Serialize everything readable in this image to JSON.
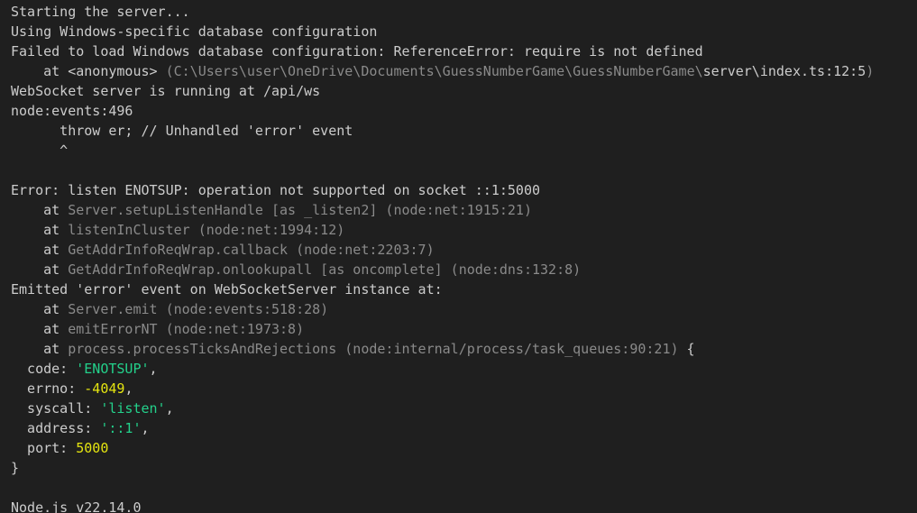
{
  "terminal": {
    "lines": [
      [
        {
          "t": "Starting the server...",
          "c": "plain"
        }
      ],
      [
        {
          "t": "Using Windows-specific database configuration",
          "c": "plain"
        }
      ],
      [
        {
          "t": "Failed to load Windows database configuration: ReferenceError: require is not defined",
          "c": "plain"
        }
      ],
      [
        {
          "t": "    at <anonymous> ",
          "c": "plain"
        },
        {
          "t": "(C:\\Users\\user\\OneDrive\\Documents\\GuessNumberGame\\GuessNumberGame\\",
          "c": "dim"
        },
        {
          "t": "server\\index.ts:12:5",
          "c": "plain"
        },
        {
          "t": ")",
          "c": "dim"
        }
      ],
      [
        {
          "t": "WebSocket server is running at /api/ws",
          "c": "plain"
        }
      ],
      [
        {
          "t": "node:events:496",
          "c": "plain"
        }
      ],
      [
        {
          "t": "      throw er; // Unhandled 'error' event",
          "c": "plain"
        }
      ],
      [
        {
          "t": "      ^",
          "c": "plain"
        }
      ],
      [
        {
          "t": "",
          "c": "plain"
        }
      ],
      [
        {
          "t": "Error: listen ENOTSUP: operation not supported on socket ::1:5000",
          "c": "plain"
        }
      ],
      [
        {
          "t": "    at ",
          "c": "plain"
        },
        {
          "t": "Server.setupListenHandle [as _listen2] (node:net:1915:21)",
          "c": "dim"
        }
      ],
      [
        {
          "t": "    at ",
          "c": "plain"
        },
        {
          "t": "listenInCluster (node:net:1994:12)",
          "c": "dim"
        }
      ],
      [
        {
          "t": "    at ",
          "c": "plain"
        },
        {
          "t": "GetAddrInfoReqWrap.callback (node:net:2203:7)",
          "c": "dim"
        }
      ],
      [
        {
          "t": "    at ",
          "c": "plain"
        },
        {
          "t": "GetAddrInfoReqWrap.onlookupall [as oncomplete] (node:dns:132:8)",
          "c": "dim"
        }
      ],
      [
        {
          "t": "Emitted 'error' event on WebSocketServer instance at:",
          "c": "plain"
        }
      ],
      [
        {
          "t": "    at ",
          "c": "plain"
        },
        {
          "t": "Server.emit (node:events:518:28)",
          "c": "dim"
        }
      ],
      [
        {
          "t": "    at ",
          "c": "plain"
        },
        {
          "t": "emitErrorNT (node:net:1973:8)",
          "c": "dim"
        }
      ],
      [
        {
          "t": "    at ",
          "c": "plain"
        },
        {
          "t": "process.processTicksAndRejections (node:internal/process/task_queues:90:21)",
          "c": "dim"
        },
        {
          "t": " {",
          "c": "plain"
        }
      ],
      [
        {
          "t": "  code: ",
          "c": "plain"
        },
        {
          "t": "'ENOTSUP'",
          "c": "str"
        },
        {
          "t": ",",
          "c": "plain"
        }
      ],
      [
        {
          "t": "  errno: ",
          "c": "plain"
        },
        {
          "t": "-4049",
          "c": "num"
        },
        {
          "t": ",",
          "c": "plain"
        }
      ],
      [
        {
          "t": "  syscall: ",
          "c": "plain"
        },
        {
          "t": "'listen'",
          "c": "str"
        },
        {
          "t": ",",
          "c": "plain"
        }
      ],
      [
        {
          "t": "  address: ",
          "c": "plain"
        },
        {
          "t": "'::1'",
          "c": "str"
        },
        {
          "t": ",",
          "c": "plain"
        }
      ],
      [
        {
          "t": "  port: ",
          "c": "plain"
        },
        {
          "t": "5000",
          "c": "num"
        }
      ],
      [
        {
          "t": "}",
          "c": "plain"
        }
      ],
      [
        {
          "t": "",
          "c": "plain"
        }
      ],
      [
        {
          "t": "Node.js v22.14.0",
          "c": "plain"
        }
      ]
    ]
  },
  "colors": {
    "background": "#1f1f1f",
    "foreground": "#cccccc",
    "dim": "#8a8a8a",
    "string": "#23d18b",
    "number": "#e5e510"
  }
}
